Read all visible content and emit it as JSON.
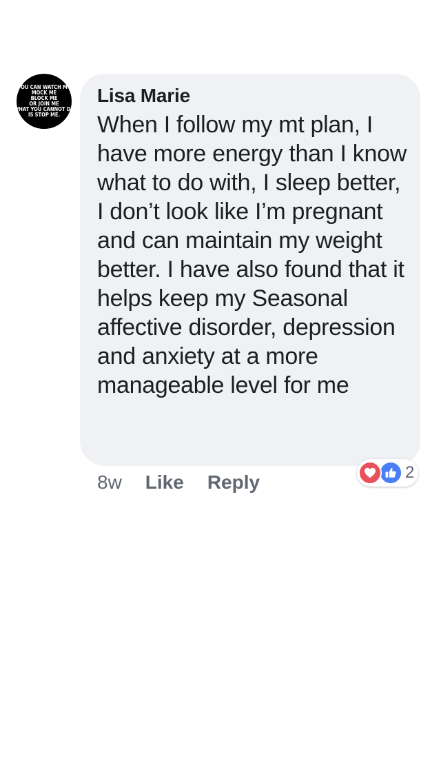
{
  "comment": {
    "avatar_text": [
      "OU CAN WATCH M",
      "MOCK ME",
      "BLOCK ME",
      "OR JOIN ME",
      "WHAT YOU CANNOT DO",
      "IS STOP ME."
    ],
    "author": "Lisa Marie",
    "text": "When I follow my mt plan, I have more energy than I know what to do with, I sleep better, I don’t look like I’m pregnant and can maintain my weight better. I have also found that it helps keep my Seasonal affective disorder, depression and anxiety at a more manageable level for me",
    "time": "8w",
    "like_label": "Like",
    "reply_label": "Reply",
    "reactions": {
      "types": [
        "love-icon",
        "like-icon"
      ],
      "love_color": "#e8505b",
      "like_color": "#4a7ef5",
      "count": "2"
    }
  }
}
